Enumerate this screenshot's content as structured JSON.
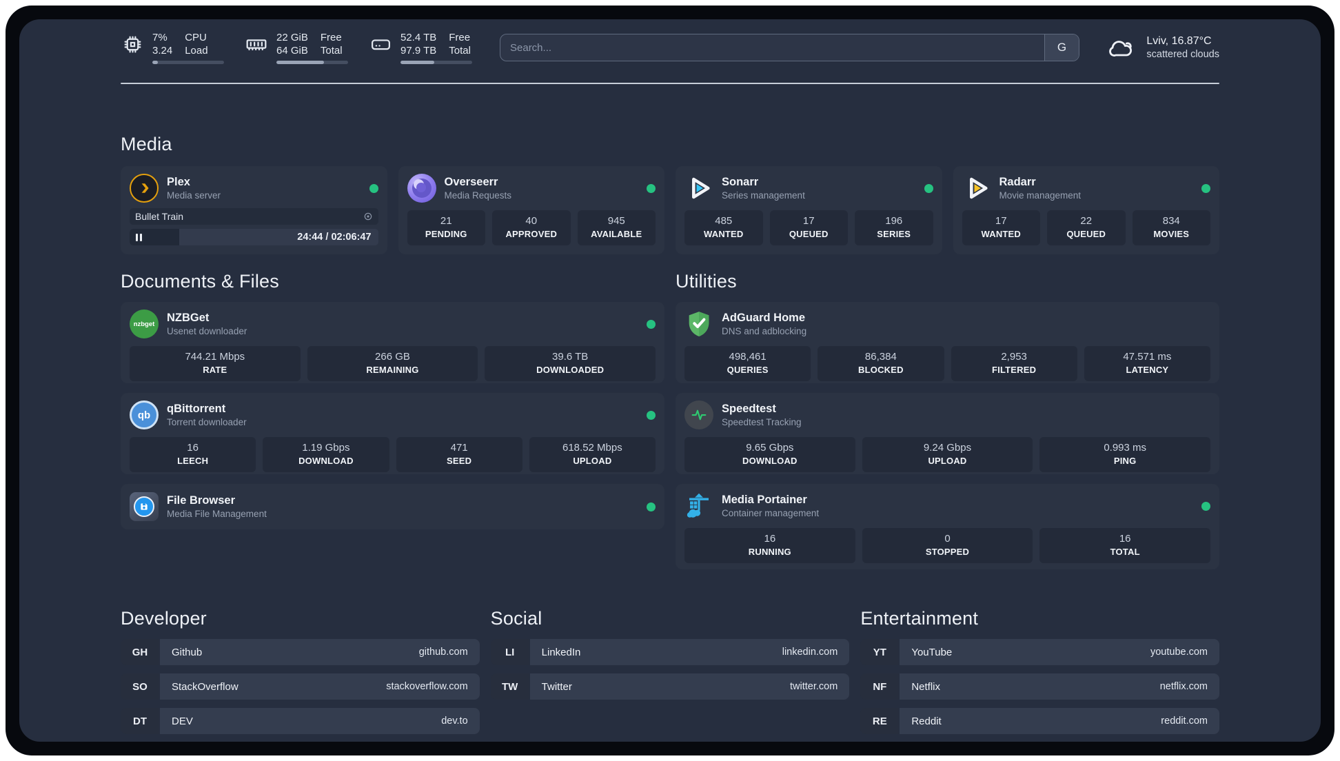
{
  "topbar": {
    "stats": [
      {
        "icon": "cpu-icon",
        "line1": "7%",
        "line2": "3.24",
        "label1": "CPU",
        "label2": "Load",
        "progress": 8
      },
      {
        "icon": "ram-icon",
        "line1": "22 GiB",
        "line2": "64 GiB",
        "label1": "Free",
        "label2": "Total",
        "progress": 66
      },
      {
        "icon": "disk-icon",
        "line1": "52.4 TB",
        "line2": "97.9 TB",
        "label1": "Free",
        "label2": "Total",
        "progress": 47
      }
    ],
    "search": {
      "placeholder": "Search...",
      "provider": "G"
    },
    "weather": {
      "icon": "cloud-icon",
      "location": "Lviv, 16.87°C",
      "condition": "scattered clouds"
    }
  },
  "sections": {
    "media": {
      "title": "Media",
      "cards": [
        {
          "icon": "plex-icon",
          "name": "Plex",
          "subtitle": "Media server",
          "online": true,
          "now_playing": {
            "title": "Bullet Train",
            "time": "24:44 / 02:06:47",
            "progress": 20
          }
        },
        {
          "icon": "overseerr-icon",
          "name": "Overseerr",
          "subtitle": "Media Requests",
          "online": true,
          "stats": [
            {
              "value": "21",
              "label": "PENDING"
            },
            {
              "value": "40",
              "label": "APPROVED"
            },
            {
              "value": "945",
              "label": "AVAILABLE"
            }
          ]
        },
        {
          "icon": "sonarr-icon",
          "name": "Sonarr",
          "subtitle": "Series management",
          "online": true,
          "stats": [
            {
              "value": "485",
              "label": "WANTED"
            },
            {
              "value": "17",
              "label": "QUEUED"
            },
            {
              "value": "196",
              "label": "SERIES"
            }
          ]
        },
        {
          "icon": "radarr-icon",
          "name": "Radarr",
          "subtitle": "Movie management",
          "online": true,
          "stats": [
            {
              "value": "17",
              "label": "WANTED"
            },
            {
              "value": "22",
              "label": "QUEUED"
            },
            {
              "value": "834",
              "label": "MOVIES"
            }
          ]
        }
      ]
    },
    "documents": {
      "title": "Documents & Files",
      "cards": [
        {
          "icon": "nzbget-icon",
          "name": "NZBGet",
          "subtitle": "Usenet downloader",
          "online": true,
          "stats": [
            {
              "value": "744.21 Mbps",
              "label": "RATE"
            },
            {
              "value": "266 GB",
              "label": "REMAINING"
            },
            {
              "value": "39.6 TB",
              "label": "DOWNLOADED"
            }
          ]
        },
        {
          "icon": "qbittorrent-icon",
          "name": "qBittorrent",
          "subtitle": "Torrent downloader",
          "online": true,
          "stats": [
            {
              "value": "16",
              "label": "LEECH"
            },
            {
              "value": "1.19 Gbps",
              "label": "DOWNLOAD"
            },
            {
              "value": "471",
              "label": "SEED"
            },
            {
              "value": "618.52 Mbps",
              "label": "UPLOAD"
            }
          ]
        },
        {
          "icon": "filebrowser-icon",
          "name": "File Browser",
          "subtitle": "Media File Management",
          "online": true
        }
      ]
    },
    "utilities": {
      "title": "Utilities",
      "cards": [
        {
          "icon": "adguard-icon",
          "name": "AdGuard Home",
          "subtitle": "DNS and adblocking",
          "stats": [
            {
              "value": "498,461",
              "label": "QUERIES"
            },
            {
              "value": "86,384",
              "label": "BLOCKED"
            },
            {
              "value": "2,953",
              "label": "FILTERED"
            },
            {
              "value": "47.571 ms",
              "label": "LATENCY"
            }
          ]
        },
        {
          "icon": "speedtest-icon",
          "name": "Speedtest",
          "subtitle": "Speedtest Tracking",
          "stats": [
            {
              "value": "9.65 Gbps",
              "label": "DOWNLOAD"
            },
            {
              "value": "9.24 Gbps",
              "label": "UPLOAD"
            },
            {
              "value": "0.993 ms",
              "label": "PING"
            }
          ]
        },
        {
          "icon": "portainer-icon",
          "name": "Media Portainer",
          "subtitle": "Container management",
          "online": true,
          "stats": [
            {
              "value": "16",
              "label": "RUNNING"
            },
            {
              "value": "0",
              "label": "STOPPED"
            },
            {
              "value": "16",
              "label": "TOTAL"
            }
          ]
        }
      ]
    },
    "developer": {
      "title": "Developer",
      "links": [
        {
          "abbr": "GH",
          "name": "Github",
          "url": "github.com"
        },
        {
          "abbr": "SO",
          "name": "StackOverflow",
          "url": "stackoverflow.com"
        },
        {
          "abbr": "DT",
          "name": "DEV",
          "url": "dev.to"
        }
      ]
    },
    "social": {
      "title": "Social",
      "links": [
        {
          "abbr": "LI",
          "name": "LinkedIn",
          "url": "linkedin.com"
        },
        {
          "abbr": "TW",
          "name": "Twitter",
          "url": "twitter.com"
        }
      ]
    },
    "entertainment": {
      "title": "Entertainment",
      "links": [
        {
          "abbr": "YT",
          "name": "YouTube",
          "url": "youtube.com"
        },
        {
          "abbr": "NF",
          "name": "Netflix",
          "url": "netflix.com"
        },
        {
          "abbr": "RE",
          "name": "Reddit",
          "url": "reddit.com"
        }
      ]
    }
  },
  "colors": {
    "page_bg": "#262e3f",
    "card_bg": "#2b3343",
    "tile_bg": "#232a39",
    "status_online": "#26c281",
    "plex_accent": "#e5a00d",
    "sonarr_accent": "#35c5f4",
    "radarr_accent": "#f7c325",
    "nzbget_green": "#3c9c45",
    "qbittorrent_blue": "#4a90d9",
    "adguard_green": "#5cb767",
    "speedtest_green": "#2ecc71",
    "portainer_blue": "#33b1e8",
    "filebrowser_blue": "#2396ee"
  }
}
